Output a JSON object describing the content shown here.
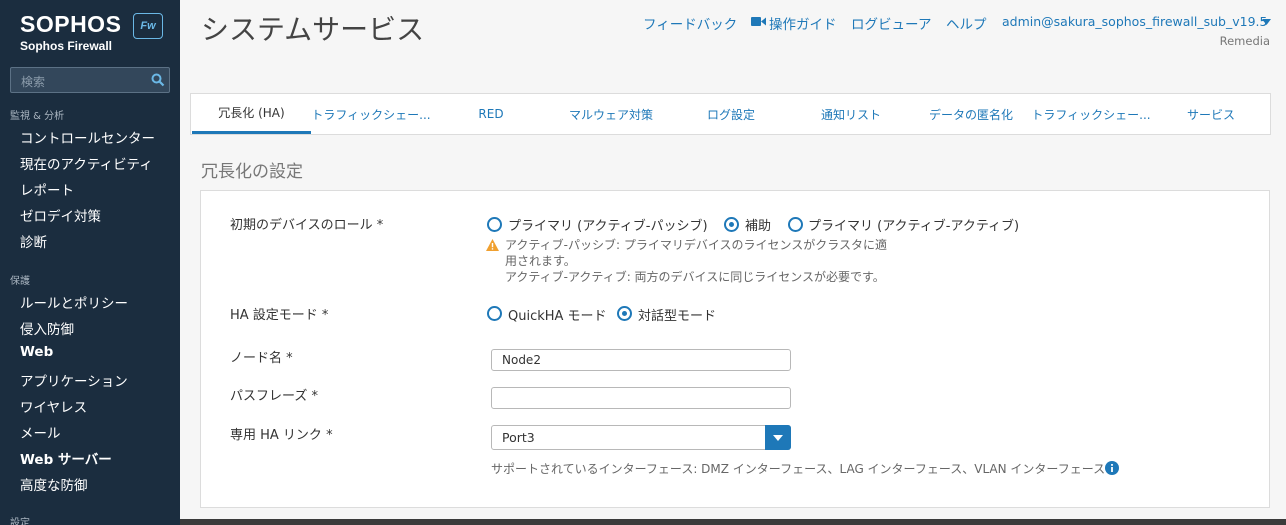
{
  "sidebar": {
    "brand": "SOPHOS",
    "product": "Sophos Firewall",
    "badge": "Fw",
    "search_placeholder": "検索",
    "sections": [
      {
        "label": "監視 & 分析",
        "items": [
          "コントロールセンター",
          "現在のアクティビティ",
          "レポート",
          "ゼロデイ対策",
          "診断"
        ]
      },
      {
        "label": "保護",
        "items": [
          "ルールとポリシー",
          "侵入防御",
          "Web",
          "アプリケーション",
          "ワイヤレス",
          "メール",
          "Web サーバー",
          "高度な防御"
        ]
      },
      {
        "label": "設定",
        "items": []
      }
    ]
  },
  "header": {
    "title": "システムサービス",
    "links": [
      "フィードバック",
      "操作ガイド",
      "ログビューア",
      "ヘルプ"
    ],
    "user": "admin@sakura_sophos_firewall_sub_v19.5",
    "org": "Remedia"
  },
  "tabs": [
    "冗長化 (HA)",
    "トラフィックシェー...",
    "RED",
    "マルウェア対策",
    "ログ設定",
    "通知リスト",
    "データの匿名化",
    "トラフィックシェー...",
    "サービス"
  ],
  "section_title": "冗長化の設定",
  "form": {
    "role": {
      "label": "初期のデバイスのロール *",
      "options": [
        "プライマリ (アクティブ-パッシブ)",
        "補助",
        "プライマリ (アクティブ-アクティブ)"
      ],
      "selected": "補助",
      "help_line1": "アクティブ-パッシブ: プライマリデバイスのライセンスがクラスタに適",
      "help_line2": "用されます。",
      "help_line3": "アクティブ-アクティブ: 両方のデバイスに同じライセンスが必要です。"
    },
    "mode": {
      "label": "HA 設定モード *",
      "options": [
        "QuickHA モード",
        "対話型モード"
      ],
      "selected": "対話型モード"
    },
    "node": {
      "label": "ノード名 *",
      "value": "Node2"
    },
    "passphrase": {
      "label": "パスフレーズ *",
      "value": ""
    },
    "link": {
      "label": "専用 HA リンク *",
      "value": "Port3",
      "help": "サポートされているインターフェース: DMZ インターフェース、LAG インターフェース、VLAN インターフェース"
    }
  },
  "colors": {
    "accent": "#1e78b8",
    "sidebar": "#1b2d3f",
    "warn": "#f0a030"
  }
}
